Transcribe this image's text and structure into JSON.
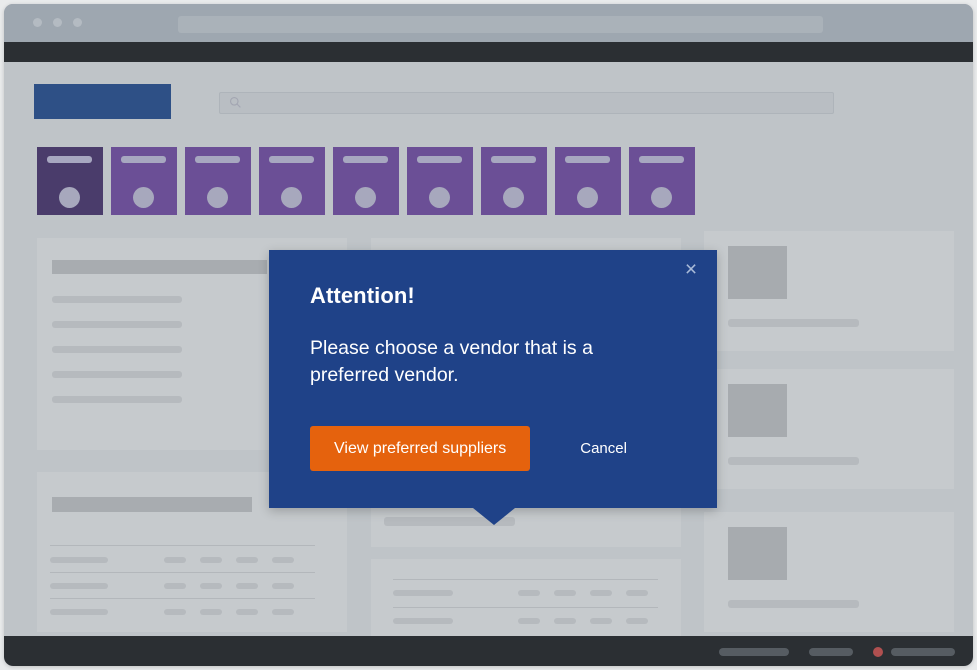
{
  "browser": {
    "traffic_dots": [
      "dot-1",
      "dot-2",
      "dot-3"
    ],
    "url_placeholder": ""
  },
  "app": {
    "logo_label": "",
    "search": {
      "icon": "search-icon",
      "value": "",
      "placeholder": ""
    }
  },
  "tiles": [
    {
      "id": "tile-1",
      "selected": true
    },
    {
      "id": "tile-2",
      "selected": false
    },
    {
      "id": "tile-3",
      "selected": false
    },
    {
      "id": "tile-4",
      "selected": false
    },
    {
      "id": "tile-5",
      "selected": false
    },
    {
      "id": "tile-6",
      "selected": false
    },
    {
      "id": "tile-7",
      "selected": false
    },
    {
      "id": "tile-8",
      "selected": false
    },
    {
      "id": "tile-9",
      "selected": false
    }
  ],
  "modal": {
    "title": "Attention!",
    "message": "Please choose a vendor that is a preferred vendor.",
    "primary_label": "View preferred suppliers",
    "cancel_label": "Cancel",
    "close_icon": "×",
    "background_color": "#1f4288",
    "primary_color": "#e5620d"
  },
  "colors": {
    "page_background": "#bfc4c8",
    "chrome": "#9ea7b0",
    "navbar": "#2b2f33",
    "logo": "#2e5086",
    "tile": "#6b4f96",
    "tile_selected": "#4a3c6b",
    "card": "#c6cacd",
    "status_indicator": "#b05050"
  },
  "statusbar": {
    "items": [
      "pill-long",
      "pill-short",
      "status-dot",
      "pill-medium"
    ]
  }
}
